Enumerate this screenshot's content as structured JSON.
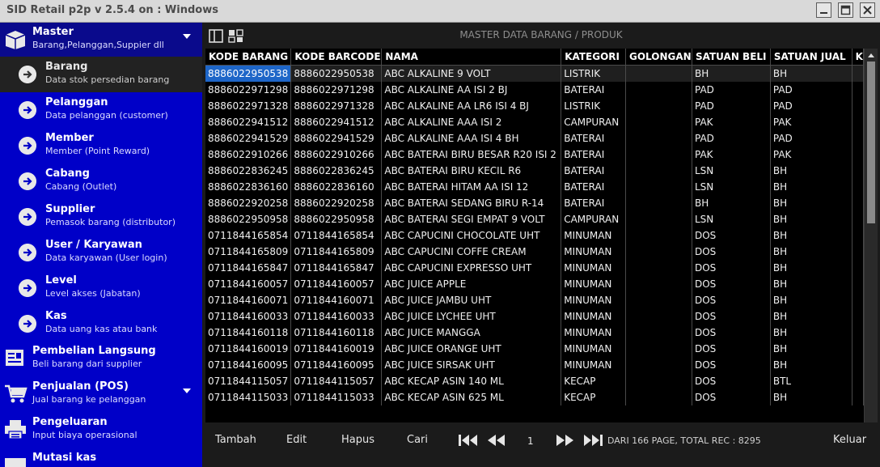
{
  "window": {
    "title": "SID Retail p2p v 2.5.4 on : Windows"
  },
  "sidebar": {
    "groups": [
      {
        "title": "Master",
        "subtitle": "Barang,Pelanggan,Suppier dll",
        "icon": "box-icon"
      },
      {
        "title": "Pembelian Langsung",
        "subtitle": "Beli barang dari supplier",
        "icon": "purchase-icon"
      },
      {
        "title": "Penjualan (POS)",
        "subtitle": "Jual barang ke pelanggan",
        "icon": "cart-icon"
      },
      {
        "title": "Pengeluaran",
        "subtitle": "Input biaya operasional",
        "icon": "printer-icon"
      },
      {
        "title": "Mutasi kas",
        "subtitle": "",
        "icon": "cash-icon"
      }
    ],
    "items": [
      {
        "title": "Barang",
        "subtitle": "Data stok persedian barang",
        "active": true
      },
      {
        "title": "Pelanggan",
        "subtitle": "Data pelanggan (customer)"
      },
      {
        "title": "Member",
        "subtitle": "Member (Point Reward)"
      },
      {
        "title": "Cabang",
        "subtitle": "Cabang (Outlet)"
      },
      {
        "title": "Supplier",
        "subtitle": "Pemasok barang (distributor)"
      },
      {
        "title": "User / Karyawan",
        "subtitle": "Data karyawan (User login)"
      },
      {
        "title": "Level",
        "subtitle": "Level akses (Jabatan)"
      },
      {
        "title": "Kas",
        "subtitle": "Data uang kas atau bank"
      }
    ]
  },
  "main": {
    "page_title": "MASTER DATA BARANG / PRODUK",
    "columns": [
      "KODE BARANG",
      "KODE BARCODE",
      "NAMA",
      "KATEGORI",
      "GOLONGAN",
      "SATUAN BELI",
      "SATUAN JUAL",
      "K"
    ],
    "rows": [
      [
        "8886022950538",
        "8886022950538",
        "ABC ALKALINE 9 VOLT",
        "LISTRIK",
        "",
        "BH",
        "BH"
      ],
      [
        "8886022971298",
        "8886022971298",
        "ABC ALKALINE AA ISI 2 BJ",
        "BATERAI",
        "",
        "PAD",
        "PAD"
      ],
      [
        "8886022971328",
        "8886022971328",
        "ABC ALKALINE AA LR6 ISI 4 BJ",
        "LISTRIK",
        "",
        "PAD",
        "PAD"
      ],
      [
        "8886022941512",
        "8886022941512",
        "ABC ALKALINE AAA ISI 2",
        "CAMPURAN",
        "",
        "PAK",
        "PAK"
      ],
      [
        "8886022941529",
        "8886022941529",
        "ABC ALKALINE AAA ISI 4 BH",
        "BATERAI",
        "",
        "PAD",
        "PAD"
      ],
      [
        "8886022910266",
        "8886022910266",
        "ABC BATERAI BIRU BESAR R20 ISI 2",
        "BATERAI",
        "",
        "PAK",
        "PAK"
      ],
      [
        "8886022836245",
        "8886022836245",
        "ABC BATERAI BIRU KECIL R6",
        "BATERAI",
        "",
        "LSN",
        "BH"
      ],
      [
        "8886022836160",
        "8886022836160",
        "ABC BATERAI HITAM AA ISI 12",
        "BATERAI",
        "",
        "LSN",
        "BH"
      ],
      [
        "8886022920258",
        "8886022920258",
        "ABC BATERAI SEDANG BIRU R-14",
        "BATERAI",
        "",
        "BH",
        "BH"
      ],
      [
        "8886022950958",
        "8886022950958",
        "ABC BATERAI SEGI EMPAT 9 VOLT",
        "CAMPURAN",
        "",
        "LSN",
        "BH"
      ],
      [
        "0711844165854",
        "0711844165854",
        "ABC CAPUCINI CHOCOLATE UHT",
        "MINUMAN",
        "",
        "DOS",
        "BH"
      ],
      [
        "0711844165809",
        "0711844165809",
        "ABC CAPUCINI COFFE CREAM",
        "MINUMAN",
        "",
        "DOS",
        "BH"
      ],
      [
        "0711844165847",
        "0711844165847",
        "ABC CAPUCINI EXPRESSO UHT",
        "MINUMAN",
        "",
        "DOS",
        "BH"
      ],
      [
        "0711844160057",
        "0711844160057",
        "ABC JUICE APPLE",
        "MINUMAN",
        "",
        "DOS",
        "BH"
      ],
      [
        "0711844160071",
        "0711844160071",
        "ABC JUICE JAMBU UHT",
        "MINUMAN",
        "",
        "DOS",
        "BH"
      ],
      [
        "0711844160033",
        "0711844160033",
        "ABC JUICE LYCHEE UHT",
        "MINUMAN",
        "",
        "DOS",
        "BH"
      ],
      [
        "0711844160118",
        "0711844160118",
        "ABC JUICE MANGGA",
        "MINUMAN",
        "",
        "DOS",
        "BH"
      ],
      [
        "0711844160019",
        "0711844160019",
        "ABC JUICE ORANGE UHT",
        "MINUMAN",
        "",
        "DOS",
        "BH"
      ],
      [
        "0711844160095",
        "0711844160095",
        "ABC JUICE SIRSAK UHT",
        "MINUMAN",
        "",
        "DOS",
        "BH"
      ],
      [
        "0711844115057",
        "0711844115057",
        "ABC KECAP ASIN 140 ML",
        "KECAP",
        "",
        "DOS",
        "BTL"
      ],
      [
        "0711844115033",
        "0711844115033",
        "ABC KECAP ASIN 625 ML",
        "KECAP",
        "",
        "DOS",
        "BH"
      ]
    ]
  },
  "footer": {
    "tambah": "Tambah",
    "edit": "Edit",
    "hapus": "Hapus",
    "cari": "Cari",
    "page": "1",
    "page_info": "DARI 166 PAGE, TOTAL REC : 8295",
    "keluar": "Keluar"
  },
  "colors": {
    "sidebar_bg": "#0000c8",
    "selected_cell": "#1e66c8",
    "main_bg": "#1b1b1b"
  }
}
